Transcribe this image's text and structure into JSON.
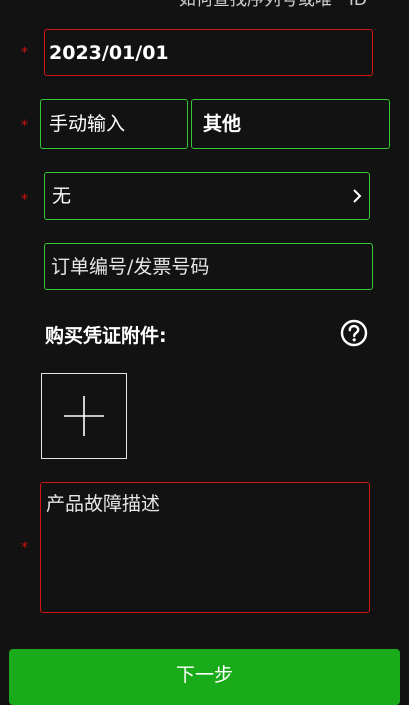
{
  "colors": {
    "background": "#121212",
    "required_star": "#d01010",
    "border_error": "#d01515",
    "border_ok": "#31c731",
    "primary_button": "#1aab1a"
  },
  "top_link": "如何查找序列号或唯一ID",
  "required_marker": "*",
  "form": {
    "purchase_date": {
      "value": "2023/01/01"
    },
    "channel": {
      "left_option": "手动输入",
      "right_option": "其他"
    },
    "dealer": {
      "value": "无",
      "icon": "chevron-right-icon"
    },
    "order_number": {
      "placeholder": "订单编号/发票号码"
    },
    "attachments": {
      "label": "购买凭证附件:",
      "help_icon": "question-circle-icon",
      "add_icon": "plus-icon"
    },
    "fault_description": {
      "placeholder": "产品故障描述"
    }
  },
  "next_button": {
    "label": "下一步"
  }
}
